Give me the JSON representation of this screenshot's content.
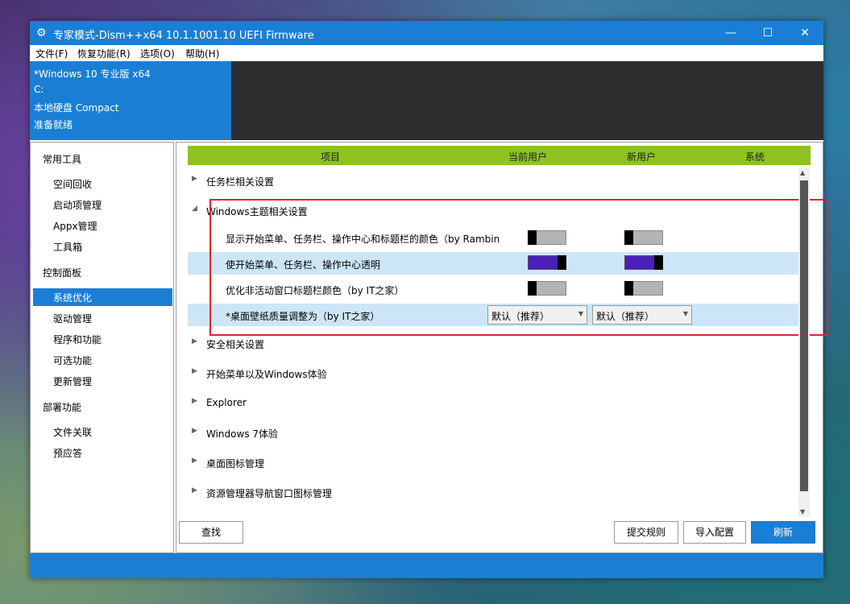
{
  "window": {
    "title": "专家模式-Dism++x64 10.1.1001.10 UEFI Firmware",
    "minimize": "—",
    "maximize": "☐",
    "close": "✕"
  },
  "menu": [
    "文件(F)",
    "恢复功能(R)",
    "选项(O)",
    "帮助(H)"
  ],
  "info": {
    "os": "*Windows 10 专业版 x64",
    "drive": "C:",
    "disk": "本地硬盘 Compact",
    "status": "准备就绪"
  },
  "sidebar": {
    "groups": [
      {
        "label": "常用工具",
        "items": [
          "空间回收",
          "启动项管理",
          "Appx管理",
          "工具箱"
        ]
      },
      {
        "label": "控制面板",
        "items": [
          "系统优化",
          "驱动管理",
          "程序和功能",
          "可选功能",
          "更新管理"
        ]
      },
      {
        "label": "部署功能",
        "items": [
          "文件关联",
          "预应答"
        ]
      }
    ],
    "selected": "系统优化"
  },
  "grid": {
    "headers": [
      "项目",
      "当前用户",
      "新用户",
      "系统"
    ],
    "sections": [
      "任务栏相关设置",
      "Windows主题相关设置",
      "安全相关设置",
      "开始菜单以及Windows体验",
      "Explorer",
      "Windows 7体验",
      "桌面图标管理",
      "资源管理器导航窗口图标管理"
    ],
    "subitems": [
      {
        "label": "显示开始菜单、任务栏、操作中心和标题栏的颜色（by Rambin",
        "current": "off",
        "new": "off"
      },
      {
        "label": "使开始菜单、任务栏、操作中心透明",
        "current": "on",
        "new": "on"
      },
      {
        "label": "优化非活动窗口标题栏颜色（by IT之家）",
        "current": "off",
        "new": "off"
      },
      {
        "label": "*桌面壁纸质量调整为（by IT之家）",
        "current": "默认（推荐）",
        "new": "默认（推荐）"
      }
    ]
  },
  "buttons": {
    "find": "查找",
    "submit": "提交规则",
    "import": "导入配置",
    "refresh": "刷新"
  },
  "colors": {
    "accent": "#1a7fd4",
    "header": "#8dc21f",
    "toggle_on": "#4a1fb8",
    "highlight_box": "#e0242a"
  }
}
